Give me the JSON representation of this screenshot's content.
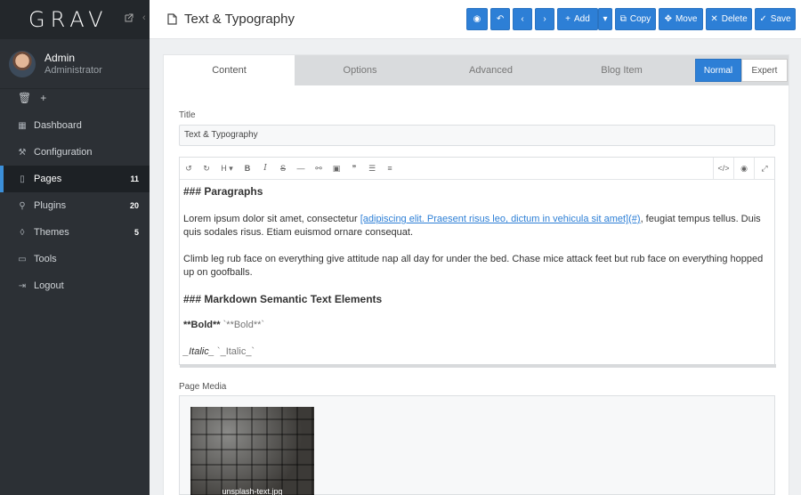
{
  "sidebar": {
    "logo": "GRAV",
    "user": {
      "name": "Admin",
      "role": "Administrator"
    },
    "quick_add": "+",
    "items": [
      {
        "label": "Dashboard",
        "icon": "dashboard-icon",
        "badge": ""
      },
      {
        "label": "Configuration",
        "icon": "wrench-icon",
        "badge": ""
      },
      {
        "label": "Pages",
        "icon": "file-icon",
        "badge": "11"
      },
      {
        "label": "Plugins",
        "icon": "plug-icon",
        "badge": "20"
      },
      {
        "label": "Themes",
        "icon": "tint-icon",
        "badge": "5"
      },
      {
        "label": "Tools",
        "icon": "briefcase-icon",
        "badge": ""
      },
      {
        "label": "Logout",
        "icon": "sign-out-icon",
        "badge": ""
      }
    ],
    "active_item": "Pages",
    "accent": "#3b8fd9"
  },
  "topbar": {
    "title": "Text & Typography",
    "buttons": {
      "add": "Add",
      "copy": "Copy",
      "move": "Move",
      "delete": "Delete",
      "save": "Save"
    },
    "button_color": "#2d7fd6"
  },
  "tabs": [
    "Content",
    "Options",
    "Advanced",
    "Blog Item"
  ],
  "active_tab": "Content",
  "mode": {
    "normal": "Normal",
    "expert": "Expert",
    "selected": "Normal"
  },
  "form": {
    "title_label": "Title",
    "title_value": "Text & Typography",
    "media_label": "Page Media",
    "media_file": "unsplash-text.jpg"
  },
  "editor": {
    "heading1": "### Paragraphs",
    "para1_start": "Lorem ipsum dolor sit amet, consectetur ",
    "para1_link": "[adipiscing elit. Praesent risus leo, dictum in vehicula sit amet](#)",
    "para1_end": ", feugiat tempus tellus. Duis quis sodales risus. Etiam euismod ornare consequat.",
    "para2": "Climb leg rub face on everything give attitude nap all day for under the bed. Chase mice attack feet but rub face on everything hopped up on goofballs.",
    "heading2": "### Markdown Semantic Text Elements",
    "bold_rendered": "**Bold**",
    "bold_code": " `**Bold**`",
    "italic_rendered": "_Italic_",
    "italic_code": " `_Italic_`"
  }
}
